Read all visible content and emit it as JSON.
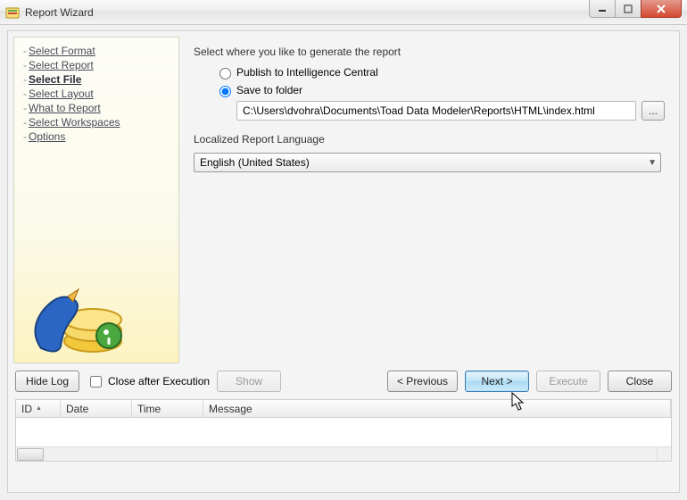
{
  "window": {
    "title": "Report Wizard"
  },
  "sidebar": {
    "items": [
      {
        "label": "Select Format"
      },
      {
        "label": "Select Report"
      },
      {
        "label": "Select File",
        "active": true
      },
      {
        "label": "Select Layout"
      },
      {
        "label": "What to Report"
      },
      {
        "label": "Select Workspaces"
      },
      {
        "label": "Options"
      }
    ]
  },
  "content": {
    "prompt": "Select where you like to generate the report",
    "radio_publish": "Publish to Intelligence Central",
    "radio_save": "Save to folder",
    "save_path": "C:\\Users\\dvohra\\Documents\\Toad Data Modeler\\Reports\\HTML\\index.html",
    "browse_label": "...",
    "lang_label": "Localized Report Language",
    "lang_value": "English (United States)"
  },
  "buttons": {
    "hide_log": "Hide Log",
    "close_after": "Close after Execution",
    "show": "Show",
    "previous": "< Previous",
    "next": "Next >",
    "execute": "Execute",
    "close": "Close"
  },
  "log": {
    "columns": {
      "id": "ID",
      "date": "Date",
      "time": "Time",
      "message": "Message"
    }
  }
}
